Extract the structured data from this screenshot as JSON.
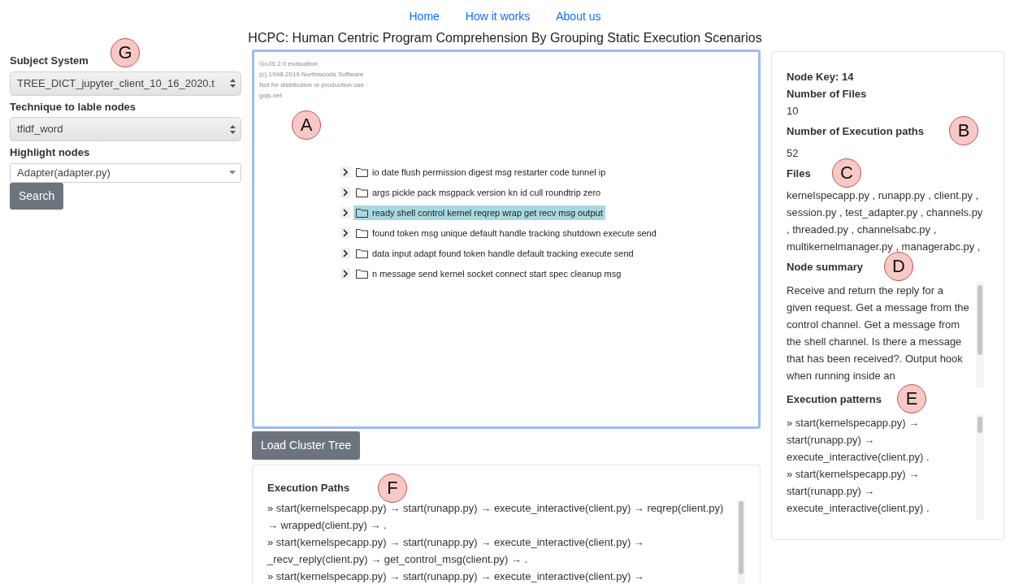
{
  "nav": {
    "links": [
      "Home",
      "How it works",
      "About us"
    ]
  },
  "title": "HCPC: Human Centric Program Comprehension By Grouping Static Execution Scenarios",
  "sidebar": {
    "fields": [
      {
        "kind": "select",
        "label": "Subject System",
        "value": "TREE_DICT_jupyter_client_10_16_2020.t",
        "callout": "G"
      },
      {
        "kind": "select",
        "label": "Technique to lable nodes",
        "value": "tfidf_word"
      },
      {
        "kind": "dropdown",
        "label": "Highlight nodes",
        "value": "Adapter(adapter.py)"
      }
    ],
    "button": "Search"
  },
  "diagram": {
    "callout": "A",
    "watermark": [
      "GoJS 2.0 evaluation",
      "(c) 1998-2019 Northwoods Software",
      "Not for distribution or production use",
      "gojs.net"
    ],
    "nodes": [
      {
        "label": "io date flush permission digest msg restarter code tunnel ip",
        "selected": false
      },
      {
        "label": "args pickle pack msgpack version kn id cull roundtrip zero",
        "selected": false
      },
      {
        "label": "ready shell control kernel reqrep wrap get recv msg output",
        "selected": true
      },
      {
        "label": "found token msg unique default handle tracking shutdown execute send",
        "selected": false
      },
      {
        "label": "data input adapt found token handle default tracking execute send",
        "selected": false
      },
      {
        "label": "n message send kernel socket connect start spec cleanup msg",
        "selected": false
      }
    ]
  },
  "load_button": "Load Cluster Tree",
  "execution_paths": {
    "heading": "Execution Paths",
    "callout": "F",
    "items": [
      "» start(kernelspecapp.py) → start(runapp.py) → execute_interactive(client.py) → reqrep(client.py) → wrapped(client.py) → .",
      "» start(kernelspecapp.py) → start(runapp.py) → execute_interactive(client.py) → _recv_reply(client.py) → get_control_msg(client.py) → .",
      "» start(kernelspecapp.py) → start(runapp.py) → execute_interactive(client.py) →"
    ]
  },
  "details": {
    "node_key": "Node Key: 14",
    "stats": [
      {
        "label": "Number of Files",
        "value": "10"
      },
      {
        "label": "Number of Execution paths",
        "value": "52",
        "callout": "B"
      }
    ],
    "files_heading": "Files",
    "files_callout": "C",
    "files": "kernelspecapp.py , runapp.py , client.py , session.py , test_adapter.py , channels.py , threaded.py , channelsabc.py , multikernelmanager.py , managerabc.py ,",
    "summary_heading": "Node summary",
    "summary_callout": "D",
    "summary": "Receive and return the reply for a given request. Get a message from the control channel. Get a message from the shell channel. Is there a message that has been received?. Output hook when running inside an",
    "patterns_heading": "Execution patterns",
    "patterns_callout": "E",
    "patterns": [
      "» start(kernelspecapp.py) → start(runapp.py) → execute_interactive(client.py) .",
      "» start(kernelspecapp.py) → start(runapp.py) → execute_interactive(client.py) ."
    ]
  }
}
